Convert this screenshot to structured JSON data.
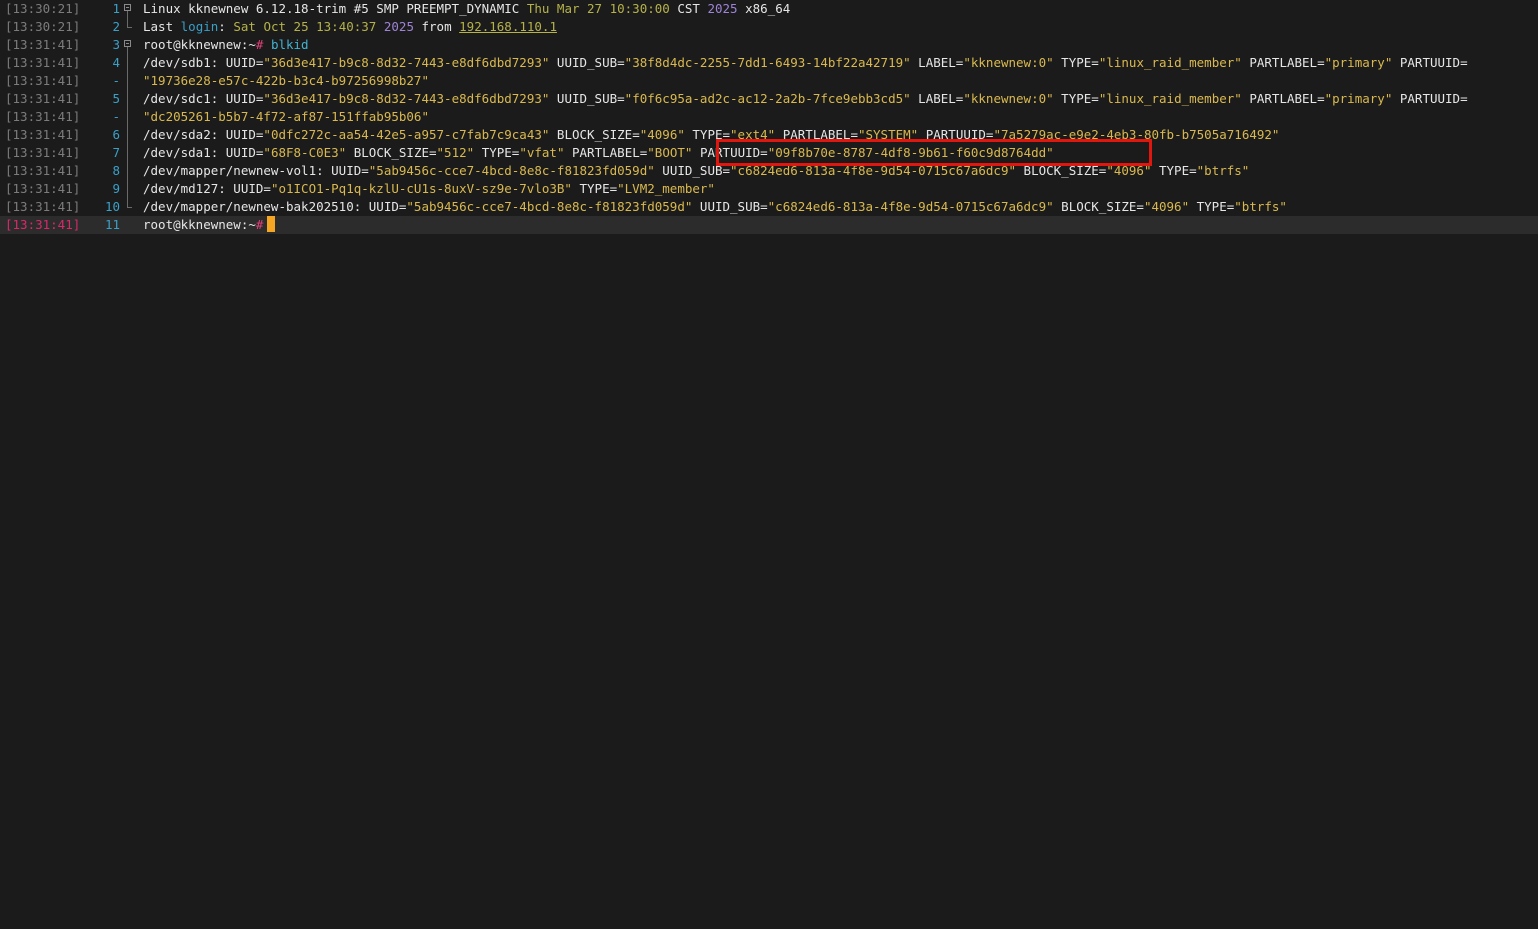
{
  "lines": [
    {
      "ts": "[13:30:21]",
      "ln": "1",
      "parts": [
        "Linux kknewnew 6.12.18-trim #5 SMP PREEMPT_DYNAMIC ",
        "Thu Mar 27 10:30:00",
        " CST ",
        "2025",
        " x86_64"
      ]
    },
    {
      "ts": "[13:30:21]",
      "ln": "2",
      "parts": [
        "Last ",
        "login",
        ": ",
        "Sat Oct 25 13:40:37",
        " ",
        "2025",
        " from ",
        "192.168.110.1"
      ]
    },
    {
      "ts": "[13:31:41]",
      "ln": "3",
      "prompt": "root@kknewnew:~",
      "hash": "#",
      "command": " blkid"
    },
    {
      "ts": "[13:31:41]",
      "ln": "4",
      "text": "/dev/sdb1: UUID=\"36d3e417-b9c8-8d32-7443-e8df6dbd7293\" UUID_SUB=\"38f8d4dc-2255-7dd1-6493-14bf22a42719\" LABEL=\"kknewnew:0\" TYPE=\"linux_raid_member\" PARTLABEL=\"primary\" PARTUUID="
    },
    {
      "ts": "[13:31:41]",
      "ln": "-",
      "text": "\"19736e28-e57c-422b-b3c4-b97256998b27\""
    },
    {
      "ts": "[13:31:41]",
      "ln": "5",
      "text": "/dev/sdc1: UUID=\"36d3e417-b9c8-8d32-7443-e8df6dbd7293\" UUID_SUB=\"f0f6c95a-ad2c-ac12-2a2b-7fce9ebb3cd5\" LABEL=\"kknewnew:0\" TYPE=\"linux_raid_member\" PARTLABEL=\"primary\" PARTUUID="
    },
    {
      "ts": "[13:31:41]",
      "ln": "-",
      "text": "\"dc205261-b5b7-4f72-af87-151ffab95b06\""
    },
    {
      "ts": "[13:31:41]",
      "ln": "6",
      "text": "/dev/sda2: UUID=\"0dfc272c-aa54-42e5-a957-c7fab7c9ca43\" BLOCK_SIZE=\"4096\" TYPE=\"ext4\" PARTLABEL=\"SYSTEM\" PARTUUID=\"7a5279ac-e9e2-4eb3-80fb-b7505a716492\""
    },
    {
      "ts": "[13:31:41]",
      "ln": "7",
      "text": "/dev/sda1: UUID=\"68F8-C0E3\" BLOCK_SIZE=\"512\" TYPE=\"vfat\" PARTLABEL=\"BOOT\" PARTUUID=\"09f8b70e-8787-4df8-9b61-f60c9d8764dd\""
    },
    {
      "ts": "[13:31:41]",
      "ln": "8",
      "text": "/dev/mapper/newnew-vol1: UUID=\"5ab9456c-cce7-4bcd-8e8c-f81823fd059d\" UUID_SUB=\"c6824ed6-813a-4f8e-9d54-0715c67a6dc9\" BLOCK_SIZE=\"4096\" TYPE=\"btrfs\""
    },
    {
      "ts": "[13:31:41]",
      "ln": "9",
      "text": "/dev/md127: UUID=\"o1ICO1-Pq1q-kzlU-cU1s-8uxV-sz9e-7vlo3B\" TYPE=\"LVM2_member\""
    },
    {
      "ts": "[13:31:41]",
      "ln": "10",
      "text": "/dev/mapper/newnew-bak202510: UUID=\"5ab9456c-cce7-4bcd-8e8c-f81823fd059d\" UUID_SUB=\"c6824ed6-813a-4f8e-9d54-0715c67a6dc9\" BLOCK_SIZE=\"4096\" TYPE=\"btrfs\""
    },
    {
      "ts": "[13:31:41]",
      "ln": "11",
      "prompt": "root@kknewnew:~",
      "hash": "#",
      "current": true
    }
  ],
  "highlight_color": "#e0160f",
  "cursor_color": "#f5a623",
  "prompt_hash_color": "#e0407a"
}
